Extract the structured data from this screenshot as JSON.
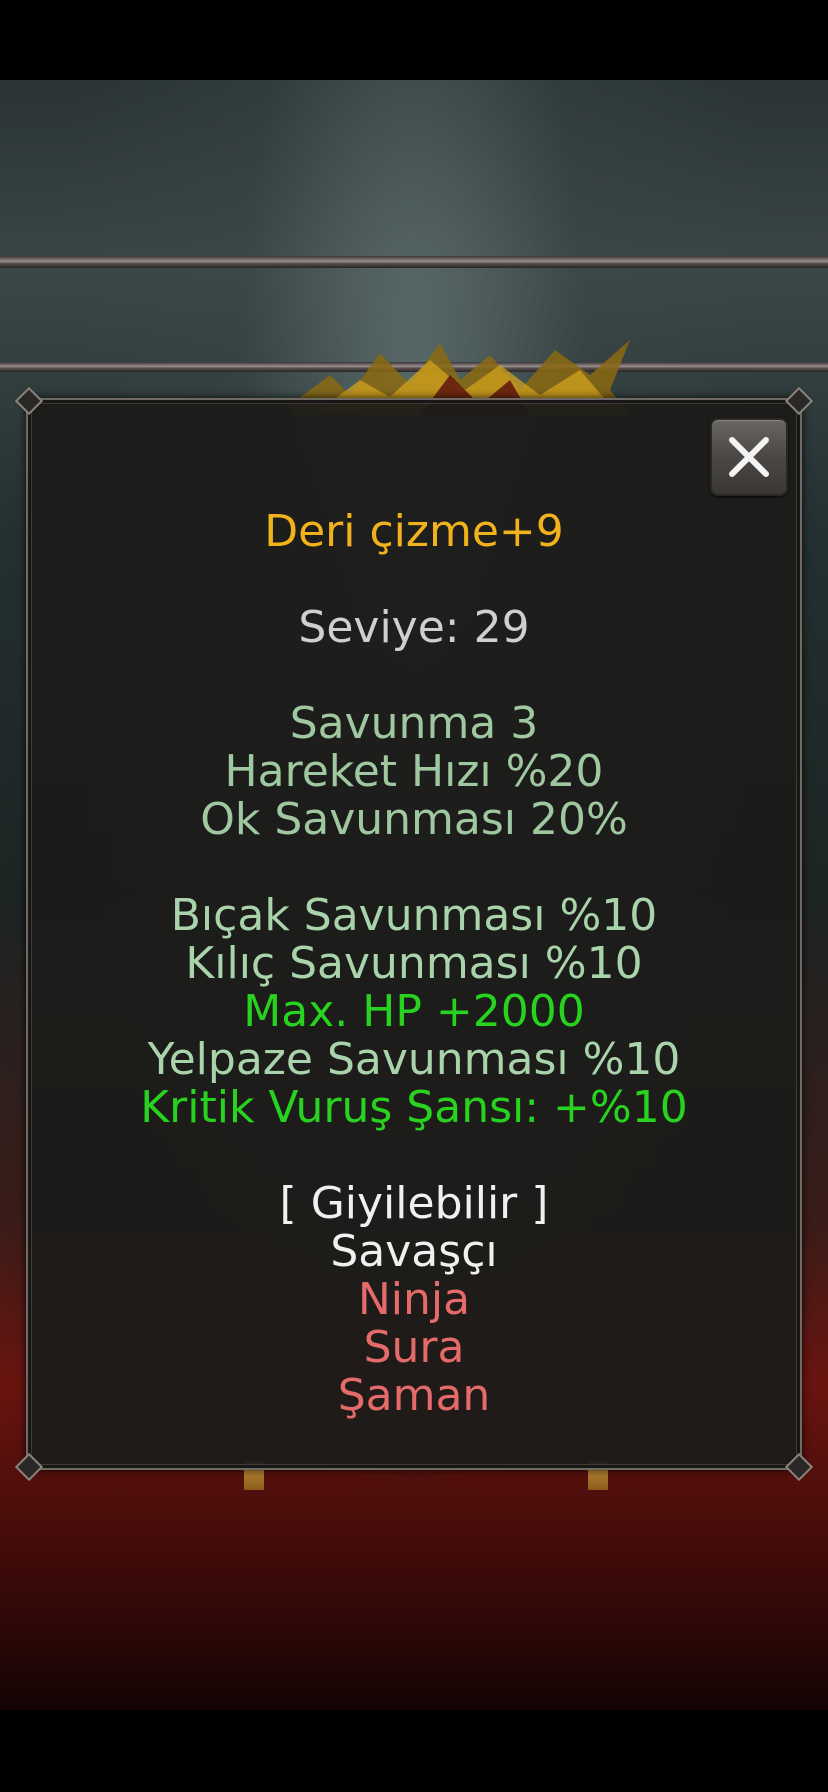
{
  "item_tooltip": {
    "close_icon": "close-x-icon",
    "title": "Deri çizme+9",
    "level": "Seviye: 29",
    "base_attributes": [
      "Savunma 3",
      "Hareket Hızı %20",
      "Ok Savunması 20%"
    ],
    "bonuses": [
      {
        "text": "Bıçak Savunması %10",
        "color": "#a9d3ab"
      },
      {
        "text": "Kılıç Savunması %10",
        "color": "#a9d3ab"
      },
      {
        "text": "Max. HP +2000",
        "color": "#27d31f"
      },
      {
        "text": "Yelpaze Savunması %10",
        "color": "#a9d3ab"
      },
      {
        "text": "Kritik Vuruş Şansı: +%10",
        "color": "#27d31f"
      }
    ],
    "wearable_header": "[ Giyilebilir ]",
    "classes": [
      {
        "text": "Savaşçı",
        "color": "#f0f0f0"
      },
      {
        "text": "Ninja",
        "color": "#e56a6a"
      },
      {
        "text": "Sura",
        "color": "#e56a6a"
      },
      {
        "text": "Şaman",
        "color": "#e56a6a"
      }
    ]
  },
  "colors": {
    "title": "#f2b21c",
    "level": "#cfcfcf",
    "base_attribute": "#9fc7a0",
    "panel_background": "#1c1c1a",
    "panel_border": "#6f6a63"
  }
}
